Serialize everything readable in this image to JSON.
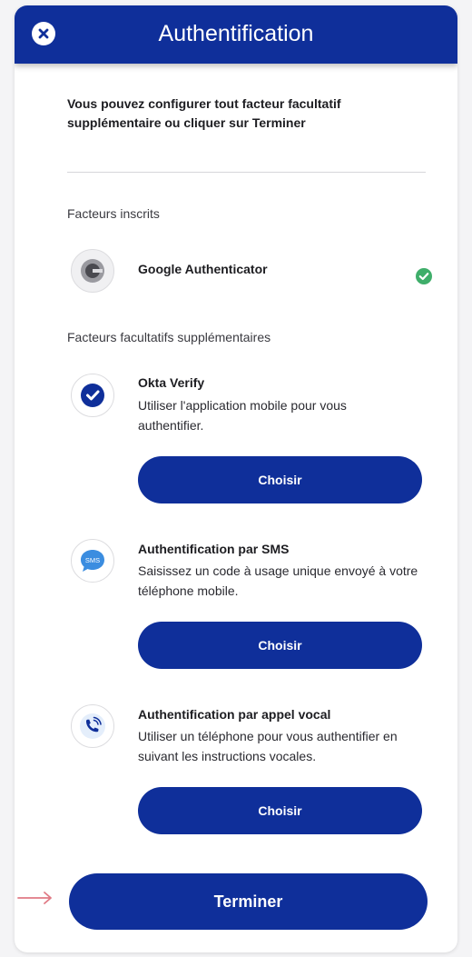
{
  "header": {
    "title": "Authentification",
    "close_icon": "close-icon",
    "color": "#0f2f9a"
  },
  "intro_text": "Vous pouvez configurer tout facteur facultatif supplémentaire ou cliquer sur Terminer",
  "enrolled": {
    "section_label": "Facteurs inscrits",
    "factors": [
      {
        "name": "Google Authenticator",
        "icon": "google-authenticator-icon",
        "status_icon": "check-circle-icon",
        "status_color": "#3fae6a"
      }
    ]
  },
  "optional": {
    "section_label": "Facteurs facultatifs supplémentaires",
    "factors": [
      {
        "name": "Okta Verify",
        "description": "Utiliser l'application mobile pour vous authentifier.",
        "icon": "okta-verify-icon",
        "button_label": "Choisir"
      },
      {
        "name": "Authentification par SMS",
        "description": "Saisissez un code à usage unique envoyé à votre téléphone mobile.",
        "icon": "sms-icon",
        "icon_text": "SMS",
        "button_label": "Choisir"
      },
      {
        "name": "Authentification par appel vocal",
        "description": "Utiliser un téléphone pour vous authentifier en suivant les instructions vocales.",
        "icon": "phone-call-icon",
        "button_label": "Choisir"
      }
    ]
  },
  "finish_button": {
    "label": "Terminer"
  },
  "pointer": {
    "icon": "arrow-right-icon",
    "color": "#e07a85"
  }
}
